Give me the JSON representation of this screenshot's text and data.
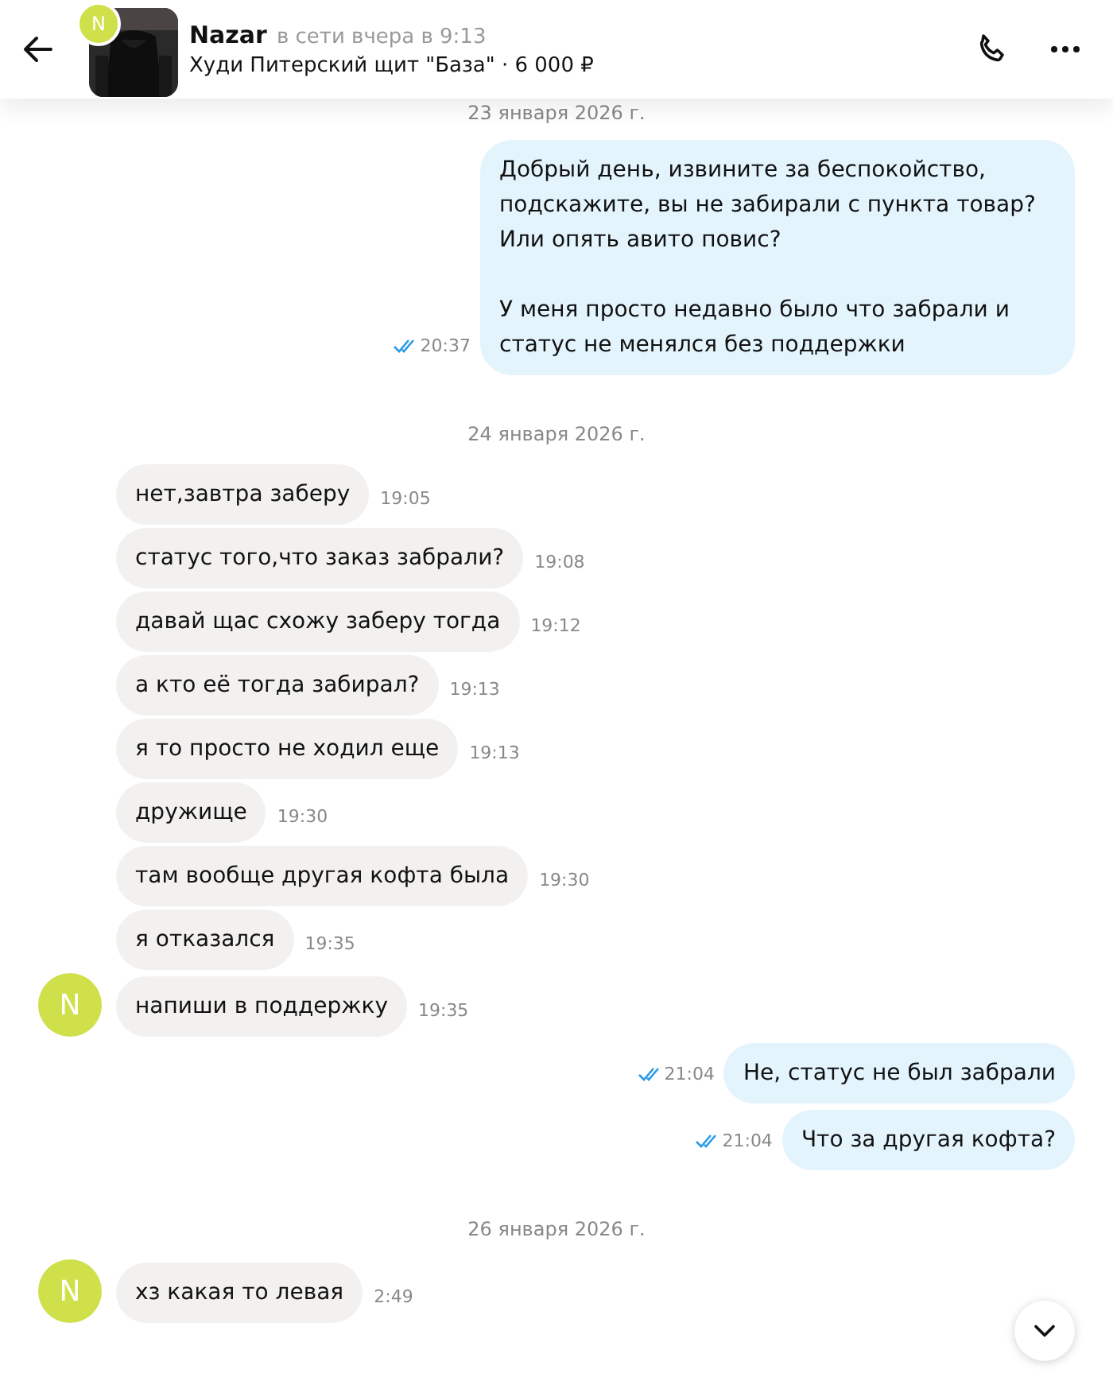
{
  "header": {
    "avatar_letter": "N",
    "name": "Nazar",
    "status": "в сети вчера в 9:13",
    "item": "Худи Питерский щит \"База\" · 6 000 ₽"
  },
  "feed": [
    {
      "kind": "date",
      "text": "23 января 2026 г."
    },
    {
      "kind": "outgoing",
      "text": "Добрый день, извините за беспокойство, подскажите, вы не забирали с пункта товар? Или опять авито повис?\n\nУ меня просто недавно было что забрали и статус не менялся без поддержки",
      "time": "20:37",
      "read": true
    },
    {
      "kind": "date",
      "text": "24 января 2026 г."
    },
    {
      "kind": "incoming",
      "text": "нет,завтра заберу",
      "time": "19:05"
    },
    {
      "kind": "incoming",
      "text": "статус того,что заказ забрали?",
      "time": "19:08"
    },
    {
      "kind": "incoming",
      "text": "давай щас схожу заберу тогда",
      "time": "19:12"
    },
    {
      "kind": "incoming",
      "text": "а кто её тогда забирал?",
      "time": "19:13"
    },
    {
      "kind": "incoming",
      "text": "я то просто не ходил еще",
      "time": "19:13"
    },
    {
      "kind": "incoming",
      "text": "дружище",
      "time": "19:30"
    },
    {
      "kind": "incoming",
      "text": "там вообще другая кофта была",
      "time": "19:30"
    },
    {
      "kind": "incoming",
      "text": "я отказался",
      "time": "19:35"
    },
    {
      "kind": "incoming",
      "text": "напиши в поддержку",
      "time": "19:35",
      "avatar_letter": "N"
    },
    {
      "kind": "outgoing",
      "text": "Не, статус не был забрали",
      "time": "21:04",
      "read": true
    },
    {
      "kind": "outgoing",
      "text": "Что за другая кофта?",
      "time": "21:04",
      "read": true
    },
    {
      "kind": "date",
      "text": "26 января 2026 г."
    },
    {
      "kind": "incoming",
      "text": "хз какая то левая",
      "time": "2:49",
      "avatar_letter": "N"
    }
  ]
}
